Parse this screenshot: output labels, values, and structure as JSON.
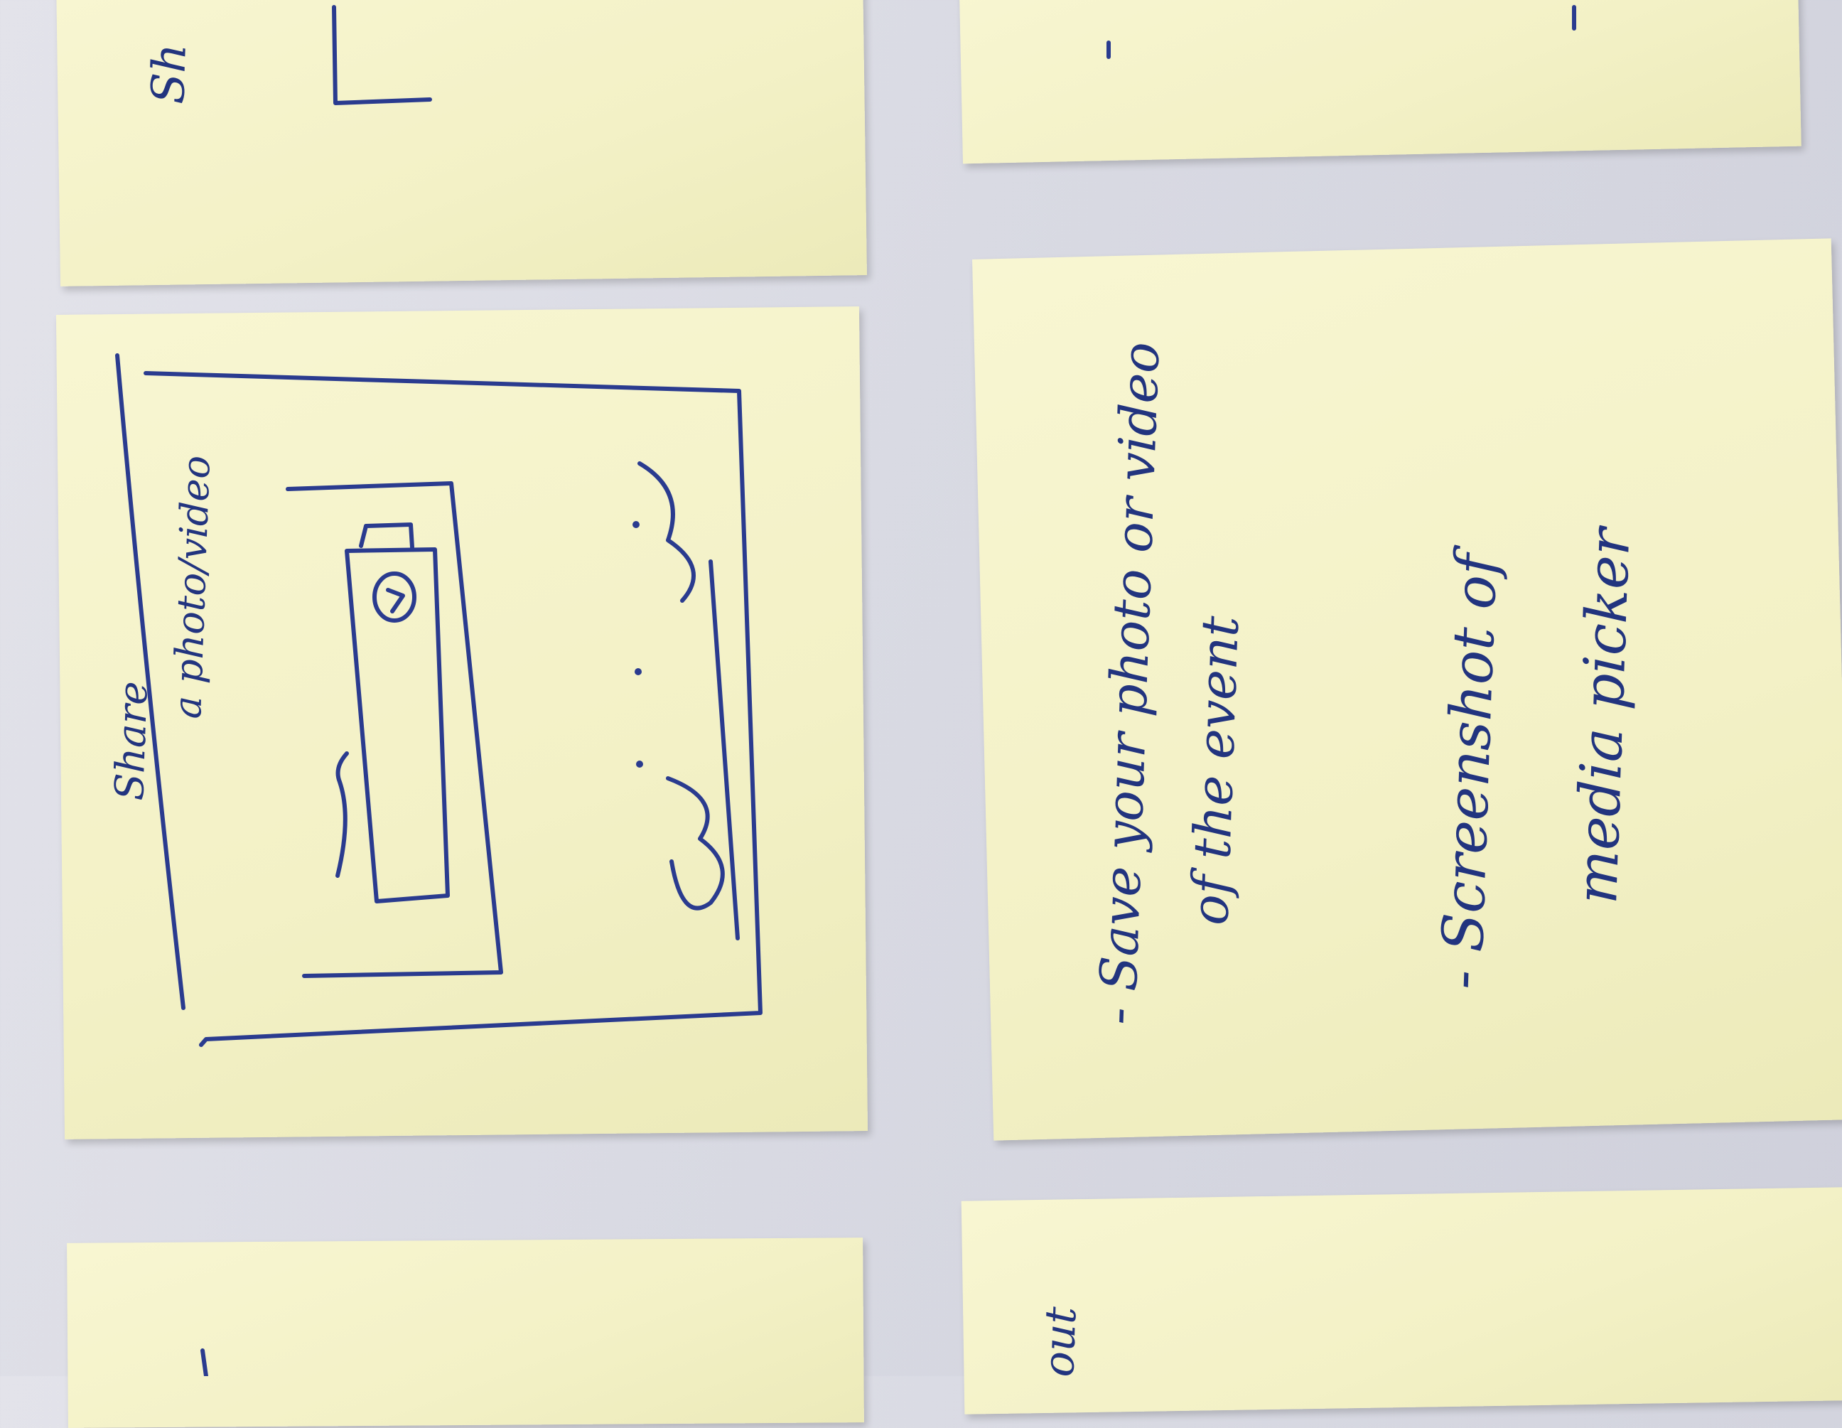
{
  "notes": {
    "sketch": {
      "title": "Share",
      "subtitle": "a photo/video"
    },
    "text_note": {
      "bullet_1": "- Save your photo or video",
      "bullet_1_line_2": "of the event",
      "bullet_2": "- Screenshot of",
      "bullet_2_line_2": "media picker"
    },
    "partial_top": "Sh",
    "partial_bottom": "out"
  },
  "colors": {
    "ink": "#2a3b8f",
    "paper": "#f6f4cc",
    "background": "#dcdde5"
  }
}
